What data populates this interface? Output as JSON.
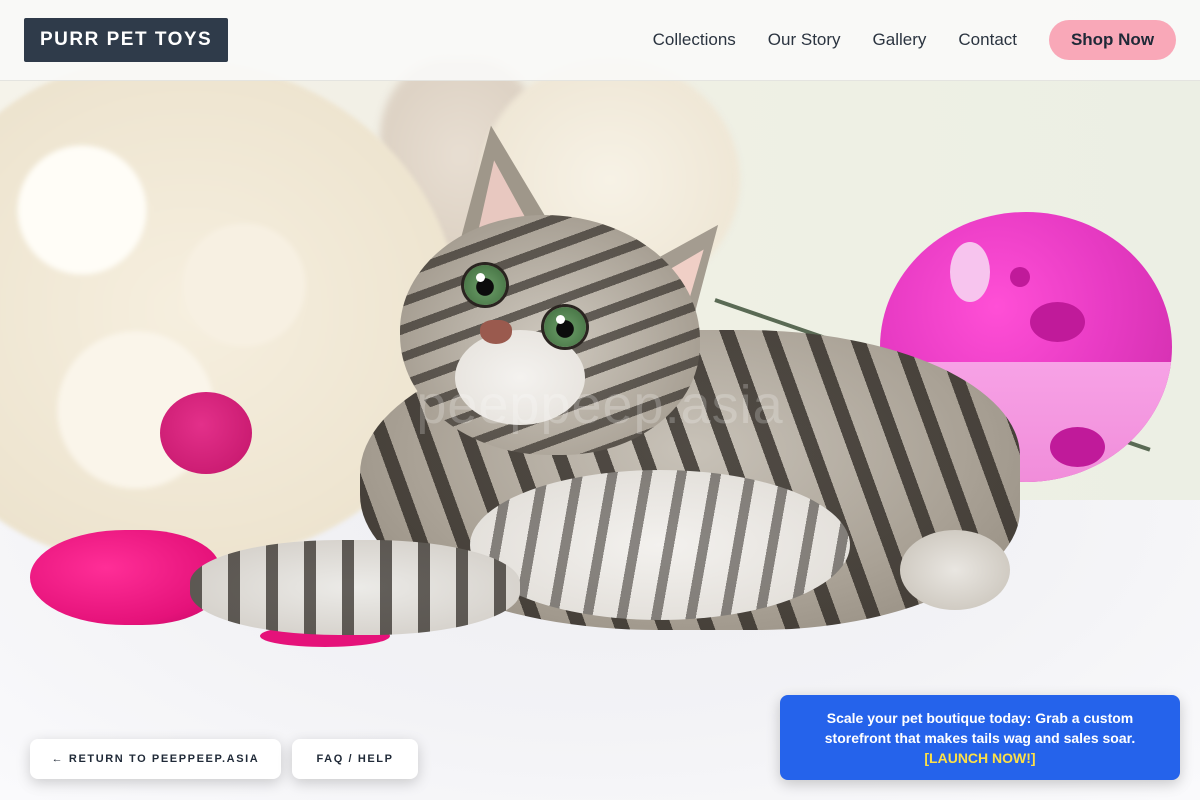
{
  "header": {
    "brand": "PURR PET TOYS",
    "nav": [
      {
        "label": "Collections"
      },
      {
        "label": "Our Story"
      },
      {
        "label": "Gallery"
      },
      {
        "label": "Contact"
      }
    ],
    "cta_label": "Shop Now"
  },
  "hero": {
    "image_semantic": "hero-photo",
    "watermark": "peeppeep.asia"
  },
  "footer_buttons": {
    "return_label": "← RETURN TO PEEPPEEP.ASIA",
    "faq_label": "FAQ / HELP"
  },
  "promo": {
    "message": "Scale your pet boutique today: Grab a custom storefront that makes tails wag and sales soar.",
    "cta": "[LAUNCH NOW!]"
  },
  "colors": {
    "logo_bg": "#2f3b4a",
    "cta_bg": "#f9a8b8",
    "promo_bg": "#2563eb",
    "promo_cta": "#fde047"
  }
}
